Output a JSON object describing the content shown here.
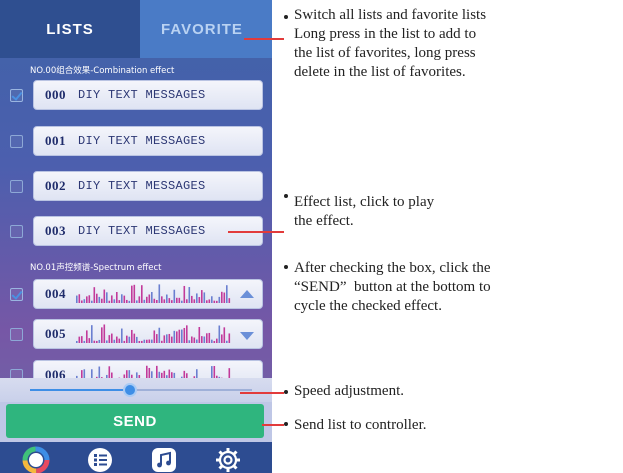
{
  "tabs": {
    "lists": "LISTS",
    "favorite": "FAVORITE"
  },
  "sections": {
    "combination": "NO.00组合效果-Combination effect",
    "spectrum": "NO.01声控频谱-Spectrum effect"
  },
  "rows": [
    {
      "num": "000",
      "text": "DIY TEXT MESSAGES",
      "checked": true
    },
    {
      "num": "001",
      "text": "DIY TEXT MESSAGES",
      "checked": false
    },
    {
      "num": "002",
      "text": "DIY TEXT MESSAGES",
      "checked": false
    },
    {
      "num": "003",
      "text": "DIY TEXT MESSAGES",
      "checked": false
    },
    {
      "num": "004",
      "checked": true
    },
    {
      "num": "005",
      "checked": false
    },
    {
      "num": "006",
      "checked": false
    }
  ],
  "speed": {
    "value_fraction": 0.45
  },
  "send": {
    "label": "SEND"
  },
  "nav": [
    "color-wheel-icon",
    "list-icon",
    "music-icon",
    "settings-icon"
  ],
  "colors": {
    "accent": "#3e8ee6",
    "send": "#2fb57e",
    "annotation_line": "#e23b3b"
  },
  "annotations": {
    "tabs": "Switch all lists and favorite lists\nLong press in the list to add to\nthe list of favorites, long press\ndelete in the list of favorites.",
    "effect_list": "Effect list, click to play\nthe effect.",
    "checkbox": "After checking the box, click the\n“SEND”  button at the bottom to\ncycle the checked effect.",
    "speed": "Speed adjustment.",
    "send": "Send list to controller."
  }
}
